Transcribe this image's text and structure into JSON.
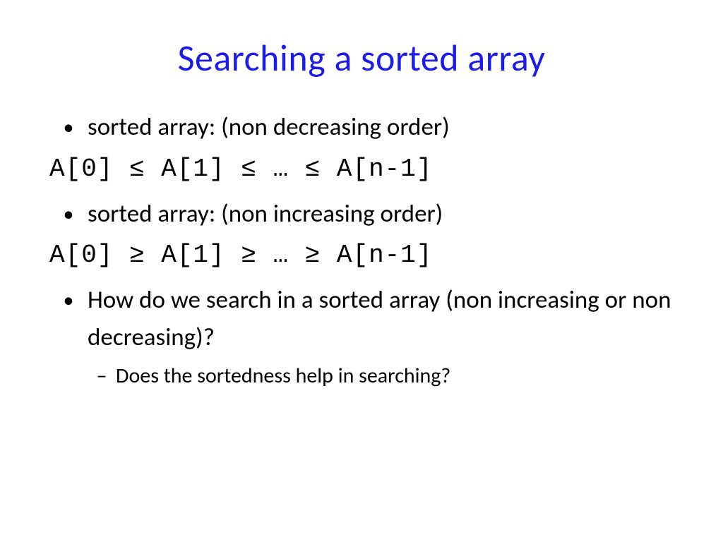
{
  "title": "Searching a sorted array",
  "items": {
    "b1": "sorted array: (non decreasing order)",
    "line1": "A[0] ≤ A[1] ≤ … ≤ A[n-1]",
    "b2": "sorted array: (non increasing order)",
    "line2": "A[0] ≥ A[1] ≥ … ≥ A[n-1]",
    "b3": "How do we search in a sorted array (non increasing or non decreasing)?",
    "sub1": "Does the sortedness help in searching?"
  }
}
